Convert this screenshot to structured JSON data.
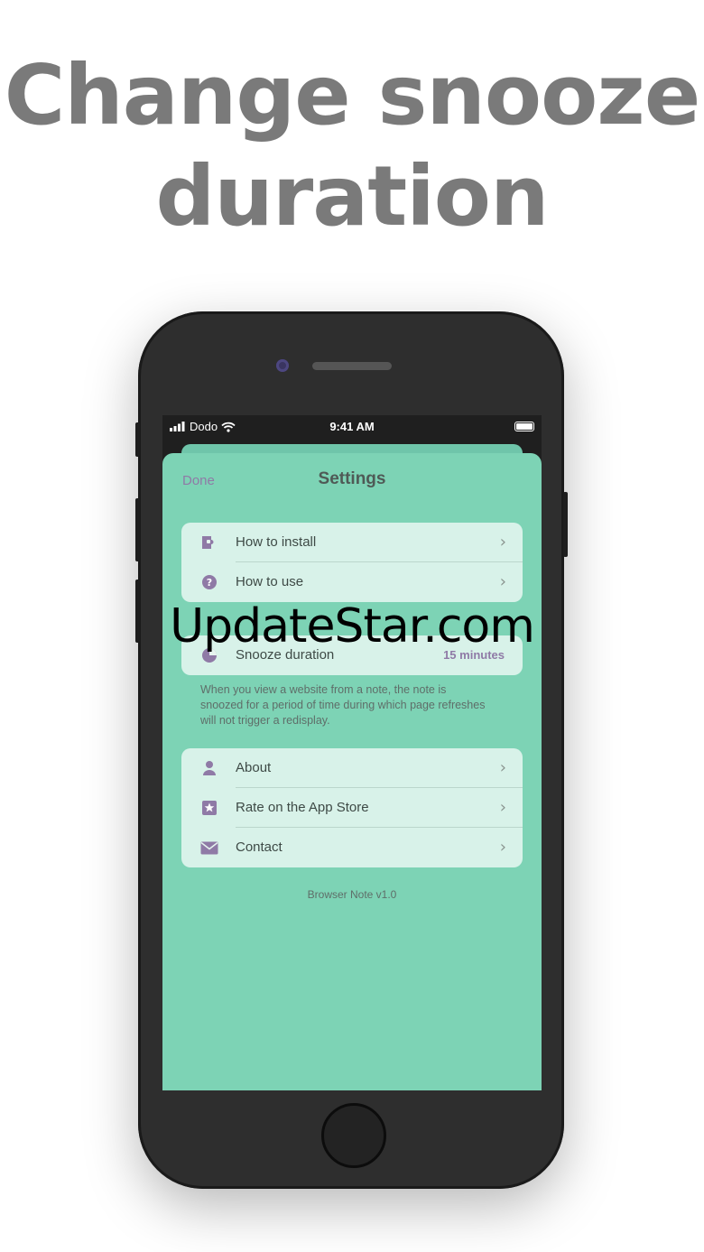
{
  "headline": {
    "line1": "Change snooze",
    "line2": "duration"
  },
  "status_bar": {
    "carrier": "Dodo",
    "time": "9:41 AM"
  },
  "nav": {
    "done_label": "Done",
    "title": "Settings"
  },
  "group_help": {
    "items": [
      {
        "label": "How to install",
        "icon": "puzzle-icon"
      },
      {
        "label": "How to use",
        "icon": "question-icon"
      }
    ]
  },
  "group_snooze": {
    "label": "Snooze duration",
    "value": "15 minutes",
    "icon": "timer-icon",
    "footnote": "When you view a website from a note, the note is snoozed for a period of time during which page refreshes will not trigger a redisplay."
  },
  "group_info": {
    "items": [
      {
        "label": "About",
        "icon": "person-icon"
      },
      {
        "label": "Rate on the App Store",
        "icon": "star-icon"
      },
      {
        "label": "Contact",
        "icon": "envelope-icon"
      }
    ]
  },
  "version": "Browser Note v1.0",
  "watermark": "UpdateStar.com",
  "colors": {
    "sheet": "#7dd3b5",
    "accent": "#8f7aa6",
    "headline": "#7a7a7a"
  }
}
